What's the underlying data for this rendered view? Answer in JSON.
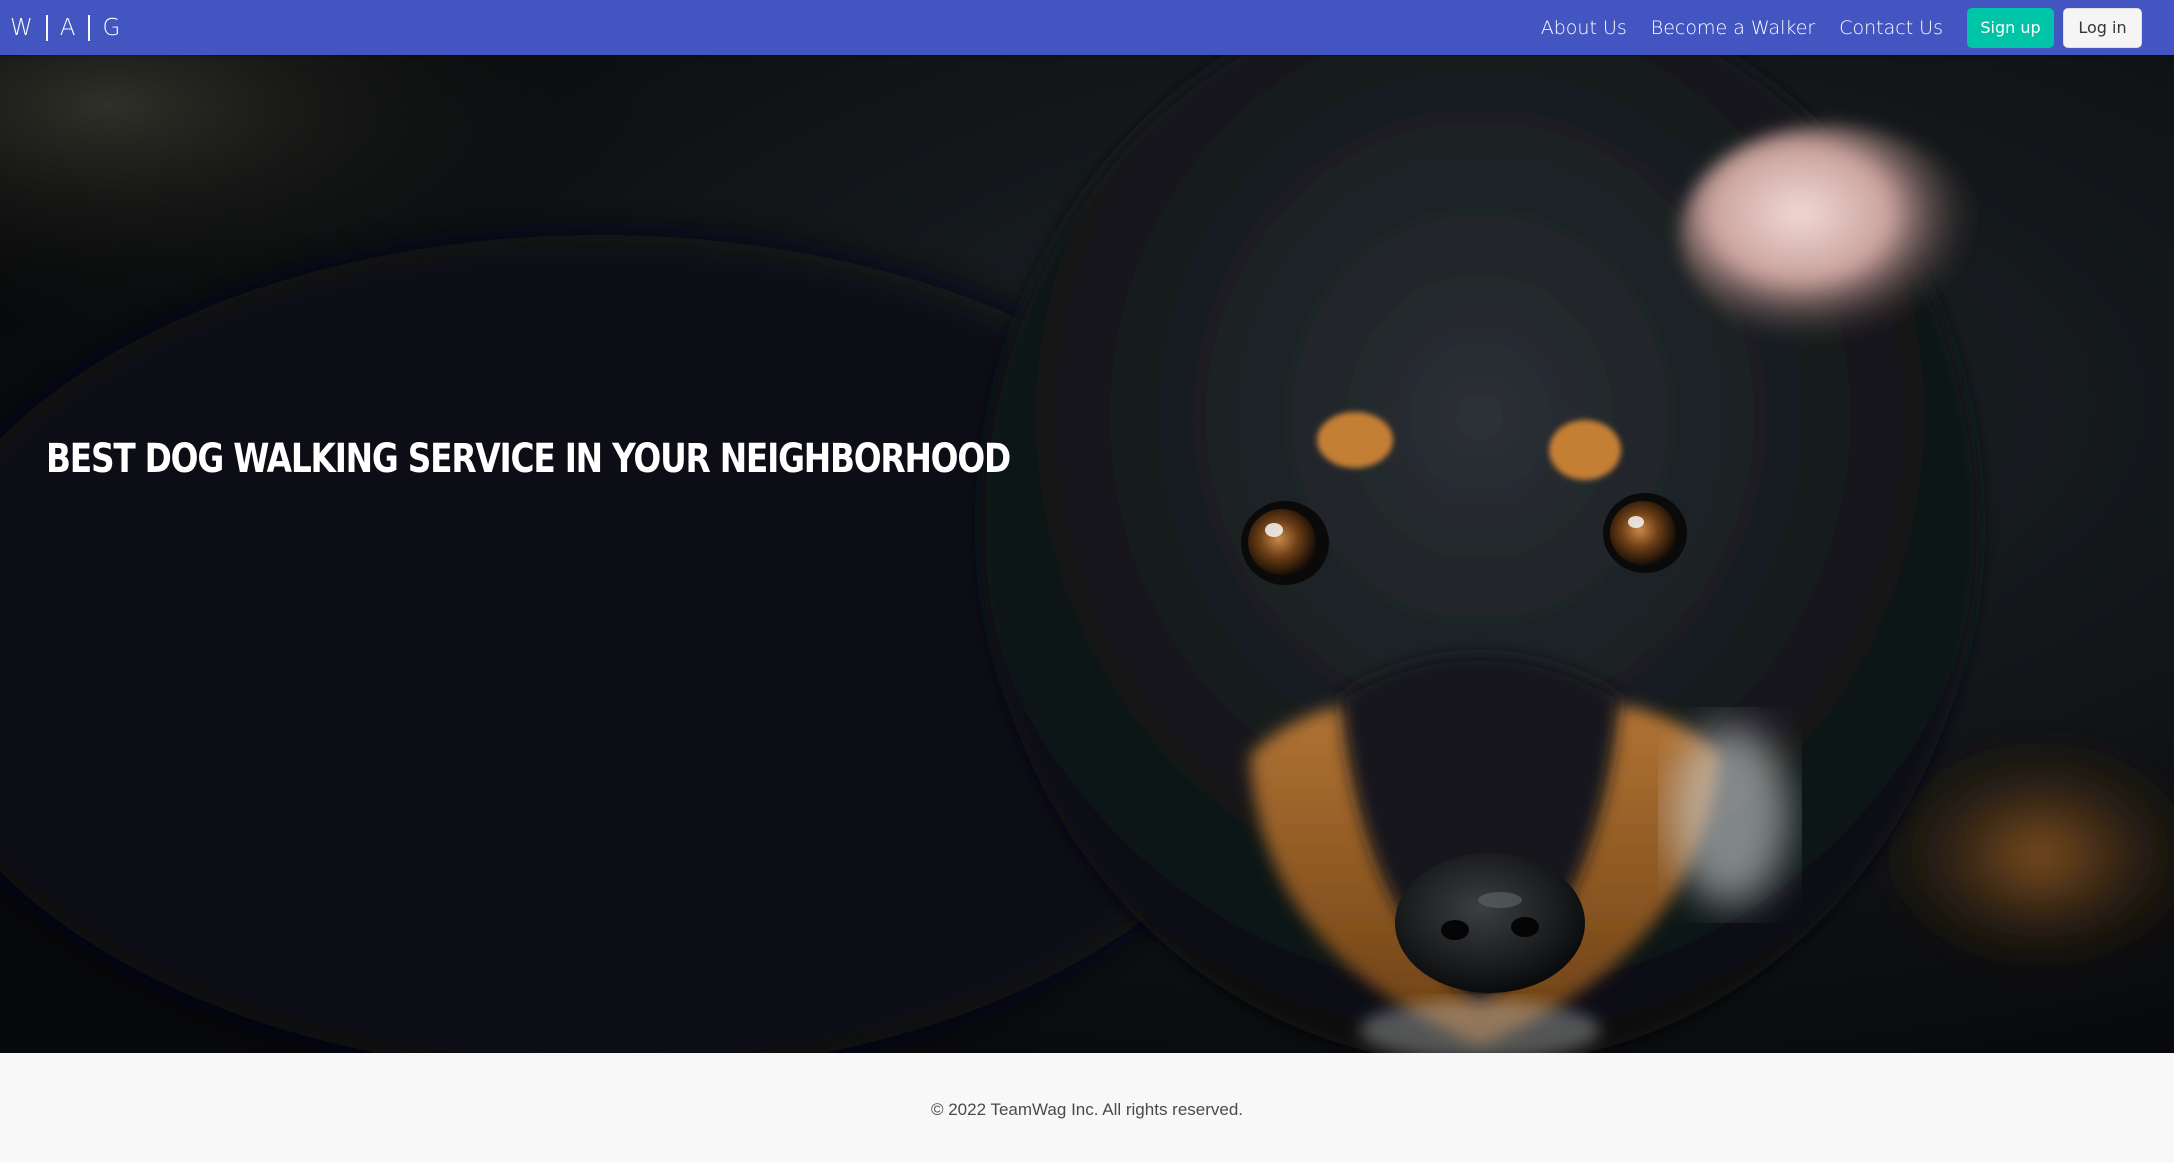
{
  "navbar": {
    "brand_letters": [
      "W",
      "A",
      "G"
    ],
    "links": [
      "About Us",
      "Become a Walker",
      "Contact Us"
    ],
    "signup_label": "Sign up",
    "login_label": "Log in"
  },
  "hero": {
    "title": "Best dog walking service in your neighborhood",
    "image_subject": "black and tan dog"
  },
  "footer": {
    "copyright": "© 2022 TeamWag Inc. All rights reserved."
  },
  "colors": {
    "navbar_bg": "#4355c0",
    "signup_bg": "#00c4a7",
    "login_bg": "#f5f5f5",
    "footer_bg": "#f8f8f8"
  }
}
